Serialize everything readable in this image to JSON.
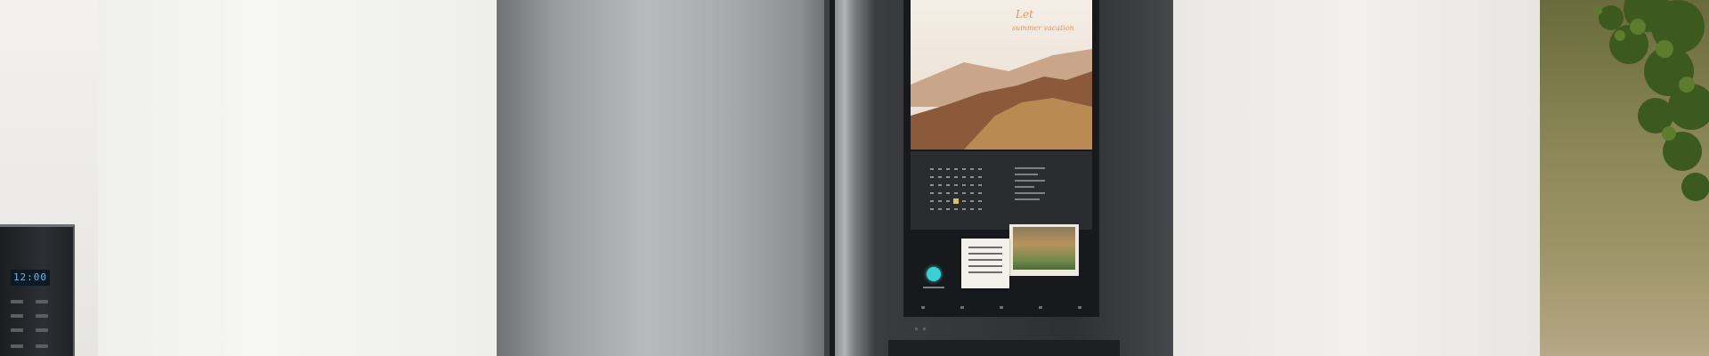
{
  "scene": {
    "description_type": "product-photo",
    "colors": {
      "wall": "#eeeeec",
      "fridge_steel": "#a9aaad",
      "fridge_black": "#2e3034",
      "screen_accent": "#39d1d6"
    }
  },
  "microwave": {
    "display": "12:00"
  }
}
